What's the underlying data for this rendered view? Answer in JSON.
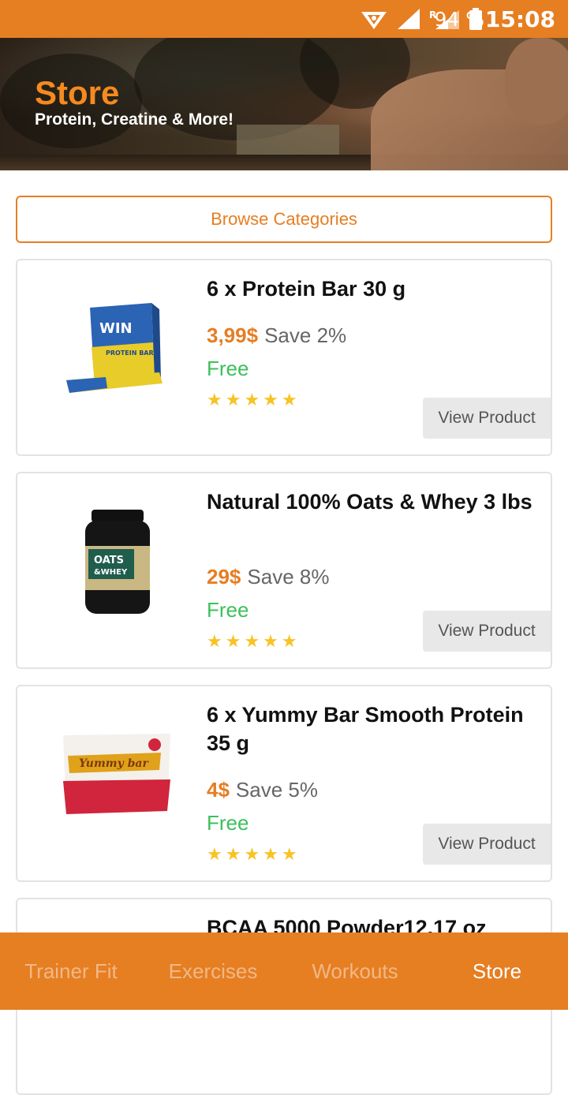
{
  "status_bar": {
    "battery": "94 %",
    "time": "15:08"
  },
  "header": {
    "title": "Store",
    "subtitle": "Protein, Creatine & More!"
  },
  "browse_label": "Browse Categories",
  "products": [
    {
      "name": "6 x Protein Bar 30 g",
      "price": "3,99$",
      "save": "Save 2%",
      "shipping": "Free",
      "stars": "★★★★★",
      "button": "View Product"
    },
    {
      "name": "Natural 100% Oats & Whey 3 lbs",
      "price": "29$",
      "save": "Save 8%",
      "shipping": "Free",
      "stars": "★★★★★",
      "button": "View Product"
    },
    {
      "name": "6 x Yummy Bar Smooth Protein 35 g",
      "price": "4$",
      "save": "Save 5%",
      "shipping": "Free",
      "stars": "★★★★★",
      "button": "View Product"
    },
    {
      "name": "BCAA 5000 Powder12.17 oz"
    }
  ],
  "nav": [
    {
      "label": "Trainer Fit"
    },
    {
      "label": "Exercises"
    },
    {
      "label": "Workouts"
    },
    {
      "label": "Store",
      "active": true
    }
  ],
  "colors": {
    "accent": "#e67e22",
    "free": "#3cc05b",
    "star": "#f7c325"
  },
  "thumbnails": {
    "win_brand": "WIN",
    "win_box": "PROTEIN BAR",
    "oats_line1": "OATS",
    "oats_line2": "&WHEY",
    "yummy_brand": "Yummy bar"
  }
}
